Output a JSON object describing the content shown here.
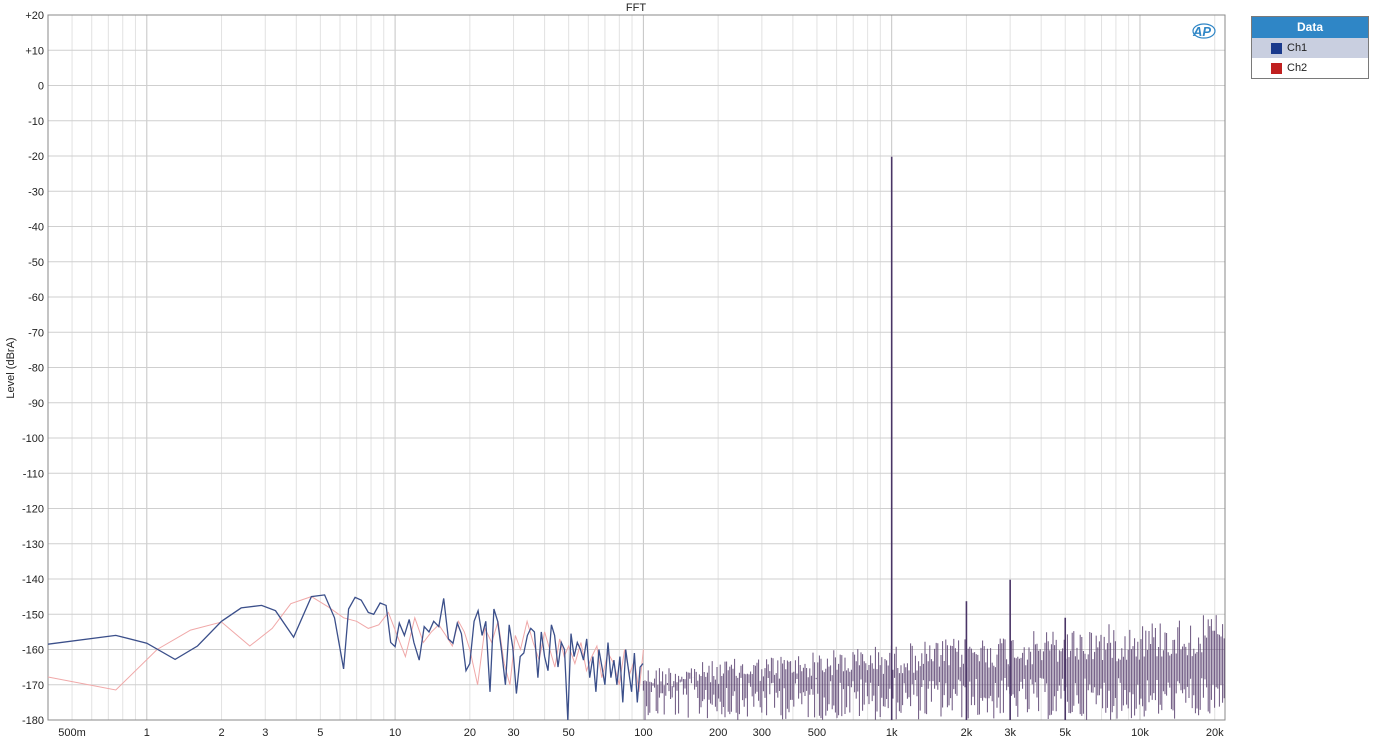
{
  "chart_data": {
    "type": "line",
    "title": "FFT",
    "xlabel": "",
    "ylabel": "Level (dBrA)",
    "x_scale": "log",
    "xlim": [
      0.4,
      22000
    ],
    "ylim": [
      -180,
      20
    ],
    "grid": true,
    "legend_title": "Data",
    "legend_position": "right",
    "logo_text": "AP",
    "y_ticks": [
      20,
      10,
      0,
      -10,
      -20,
      -30,
      -40,
      -50,
      -60,
      -70,
      -80,
      -90,
      -100,
      -110,
      -120,
      -130,
      -140,
      -150,
      -160,
      -170,
      -180
    ],
    "y_tick_labels": [
      "+20",
      "+10",
      "0",
      "-10",
      "-20",
      "-30",
      "-40",
      "-50",
      "-60",
      "-70",
      "-80",
      "-90",
      "-100",
      "-110",
      "-120",
      "-130",
      "-140",
      "-150",
      "-160",
      "-170",
      "-180"
    ],
    "x_ticks": [
      0.5,
      1,
      2,
      3,
      5,
      10,
      20,
      30,
      50,
      100,
      200,
      300,
      500,
      1000,
      2000,
      3000,
      5000,
      10000,
      20000
    ],
    "x_tick_labels": [
      "500m",
      "1",
      "2",
      "3",
      "5",
      "10",
      "20",
      "30",
      "50",
      "100",
      "200",
      "300",
      "500",
      "1k",
      "2k",
      "3k",
      "5k",
      "10k",
      "20k"
    ],
    "series": [
      {
        "name": "Ch1",
        "color": "#1a3a8c",
        "line_color": "#3b4f8a",
        "x": [
          0.4,
          0.75,
          1.0,
          1.3,
          1.6,
          2.0,
          2.4,
          2.9,
          3.3,
          3.9,
          4.6,
          5.2,
          5.7,
          6.2,
          6.5,
          6.9,
          7.3,
          7.8,
          8.2,
          8.7,
          9.2,
          9.6,
          10.0,
          10.4,
          10.9,
          11.4,
          11.9,
          12.5,
          13.1,
          13.7,
          14.3,
          15.0,
          15.7,
          16.4,
          17.1,
          17.8,
          18.5,
          19.3,
          20.0,
          20.8,
          21.6,
          22.4,
          23.2,
          24.1,
          25.0,
          25.9,
          26.8,
          27.8,
          28.8,
          29.8,
          30.8,
          31.9,
          33.0,
          34.1,
          35.2,
          36.4,
          37.6,
          38.8,
          40.0,
          41.3,
          42.6,
          43.9,
          45.3,
          46.7,
          48.1,
          49.6,
          51.1,
          52.6,
          54.2,
          55.8,
          57.4,
          59.1,
          60.8,
          62.6,
          64.4,
          66.2,
          68.1,
          70.0,
          72.0,
          74.0,
          76.1,
          78.2,
          80.4,
          82.6,
          84.9,
          87.2,
          89.6,
          92.0,
          94.5,
          97.0,
          99.6
        ],
        "y": [
          -158.5,
          -156.0,
          -158.2,
          -162.8,
          -159.0,
          -152.0,
          -148.2,
          -147.5,
          -149.0,
          -156.5,
          -145.0,
          -144.5,
          -151.0,
          -165.5,
          -148.5,
          -145.2,
          -146.0,
          -149.5,
          -150.0,
          -146.8,
          -147.5,
          -158.0,
          -159.2,
          -152.5,
          -156.0,
          -151.5,
          -158.0,
          -163.0,
          -153.5,
          -155.0,
          -152.0,
          -153.5,
          -145.5,
          -157.0,
          -158.2,
          -152.5,
          -155.5,
          -166.0,
          -164.0,
          -152.0,
          -149.0,
          -156.0,
          -152.0,
          -172.0,
          -148.5,
          -152.0,
          -160.0,
          -170.0,
          -153.0,
          -159.5,
          -172.5,
          -162.0,
          -161.0,
          -156.0,
          -154.0,
          -155.0,
          -168.0,
          -155.0,
          -162.0,
          -166.0,
          -153.0,
          -156.0,
          -165.0,
          -158.0,
          -160.0,
          -180.0,
          -155.5,
          -162.0,
          -158.0,
          -160.0,
          -163.0,
          -157.0,
          -168.0,
          -162.0,
          -172.0,
          -160.0,
          -165.0,
          -170.0,
          -158.0,
          -168.0,
          -163.0,
          -170.0,
          -162.0,
          -175.0,
          -160.0,
          -166.0,
          -172.0,
          -161.0,
          -175.0,
          -165.0,
          -164.0
        ]
      },
      {
        "name": "Ch2",
        "color": "#c02020",
        "line_color": "#f0a8a8",
        "x": [
          0.4,
          0.75,
          1.1,
          1.5,
          2.0,
          2.6,
          3.2,
          3.8,
          4.6,
          5.4,
          6.2,
          7.0,
          7.8,
          8.6,
          9.4,
          10.2,
          11.0,
          12.0,
          13.0,
          14.0,
          15.0,
          16.0,
          17.0,
          18.0,
          19.0,
          20.0,
          21.5,
          23.0,
          24.5,
          26.0,
          27.5,
          29.0,
          30.5,
          32.0,
          34.0,
          36.0,
          38.0,
          40.0,
          42.0,
          44.0,
          46.0,
          48.0,
          50.0,
          53.0,
          56.0,
          59.0,
          62.0,
          65.0,
          68.0,
          72.0,
          76.0,
          80.0,
          84.0,
          88.0,
          92.0,
          96.0,
          100.0
        ],
        "y": [
          -167.8,
          -171.5,
          -160.0,
          -154.5,
          -152.2,
          -159.0,
          -154.0,
          -147.0,
          -145.0,
          -148.0,
          -151.0,
          -152.0,
          -154.0,
          -153.0,
          -149.5,
          -156.0,
          -162.0,
          -151.0,
          -158.0,
          -155.0,
          -153.0,
          -156.0,
          -159.0,
          -152.0,
          -155.0,
          -160.0,
          -170.0,
          -154.0,
          -158.0,
          -152.0,
          -164.0,
          -170.0,
          -156.0,
          -160.0,
          -152.0,
          -158.0,
          -163.0,
          -155.0,
          -160.0,
          -165.0,
          -157.0,
          -162.0,
          -159.0,
          -164.0,
          -158.0,
          -166.0,
          -162.0,
          -159.0,
          -168.0,
          -161.0,
          -164.0,
          -170.0,
          -160.0,
          -167.0,
          -163.0,
          -172.0,
          -160.0
        ]
      }
    ],
    "hf_noise": {
      "x_start": 100,
      "x_end": 22000,
      "y_top_min": -165,
      "y_top_max": -148,
      "y_bottom_min": -180,
      "y_bottom_max": -168,
      "color": "#5a4070"
    },
    "peaks": [
      {
        "x": 1000,
        "y": -20.2
      },
      {
        "x": 2000,
        "y": -146.3
      },
      {
        "x": 3000,
        "y": -140.2
      },
      {
        "x": 5000,
        "y": -151.0
      }
    ]
  }
}
